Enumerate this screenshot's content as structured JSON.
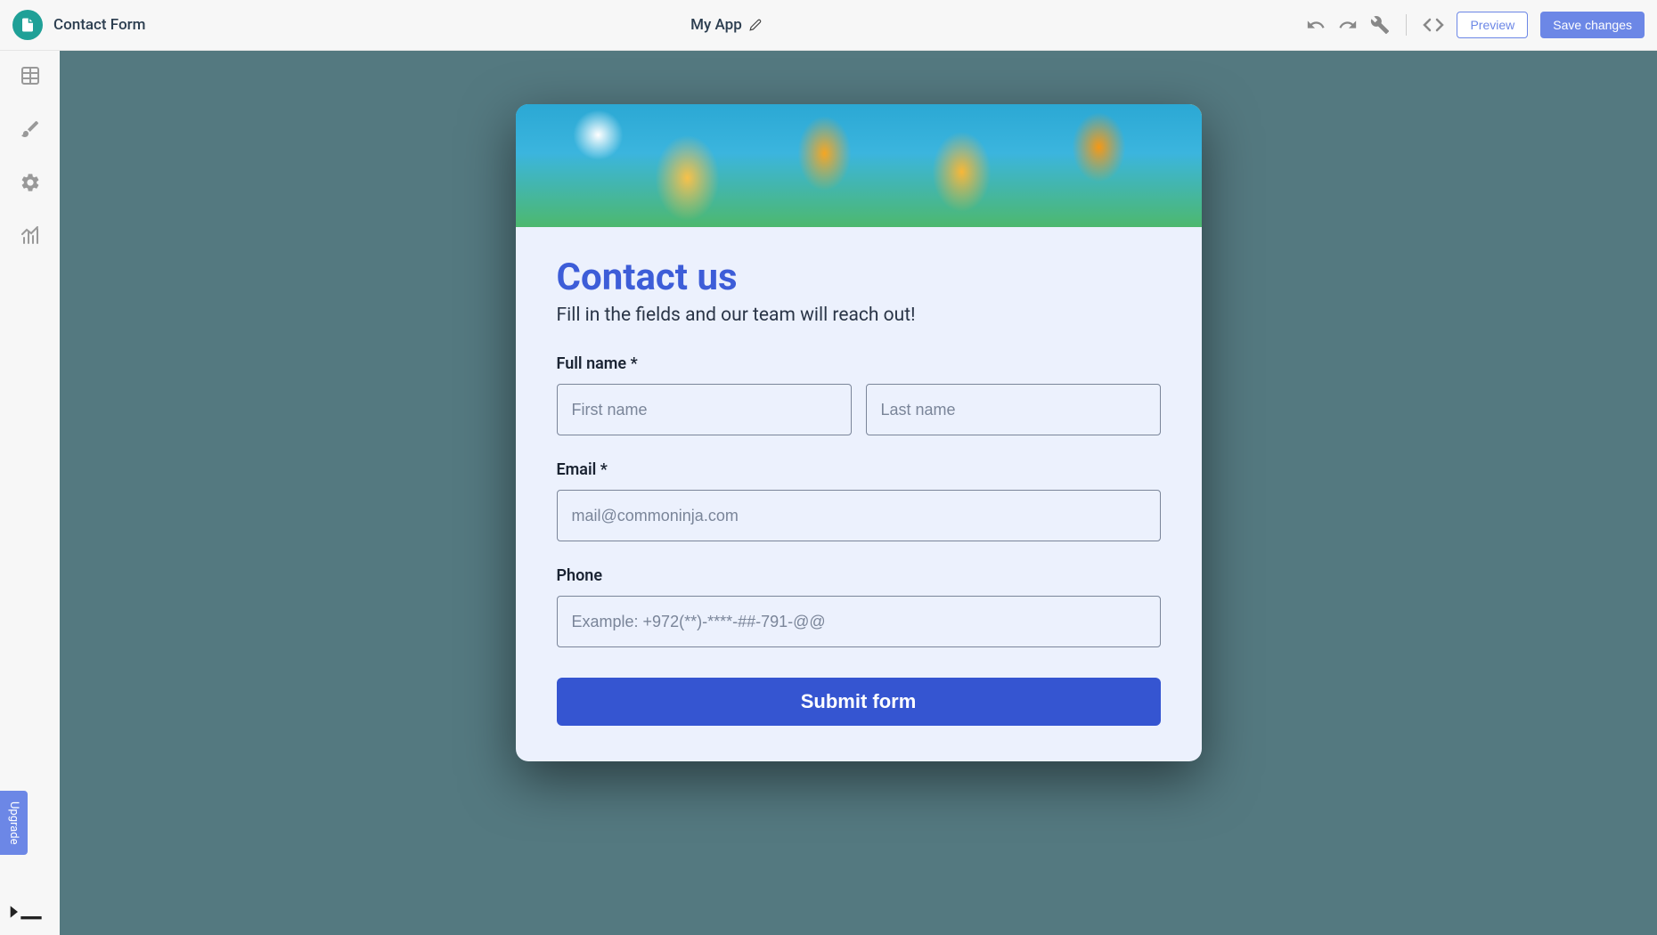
{
  "header": {
    "page_title": "Contact Form",
    "app_name": "My App",
    "preview_label": "Preview",
    "save_label": "Save changes"
  },
  "sidebar": {
    "upgrade_label": "Upgrade"
  },
  "form": {
    "title": "Contact us",
    "subtitle": "Fill in the fields and our team will reach out!",
    "fields": {
      "full_name": {
        "label": "Full name *",
        "first_placeholder": "First name",
        "last_placeholder": "Last name"
      },
      "email": {
        "label": "Email *",
        "placeholder": "mail@commoninja.com"
      },
      "phone": {
        "label": "Phone",
        "placeholder": "Example: +972(**)-****-##-791-@@"
      }
    },
    "submit_label": "Submit form"
  }
}
